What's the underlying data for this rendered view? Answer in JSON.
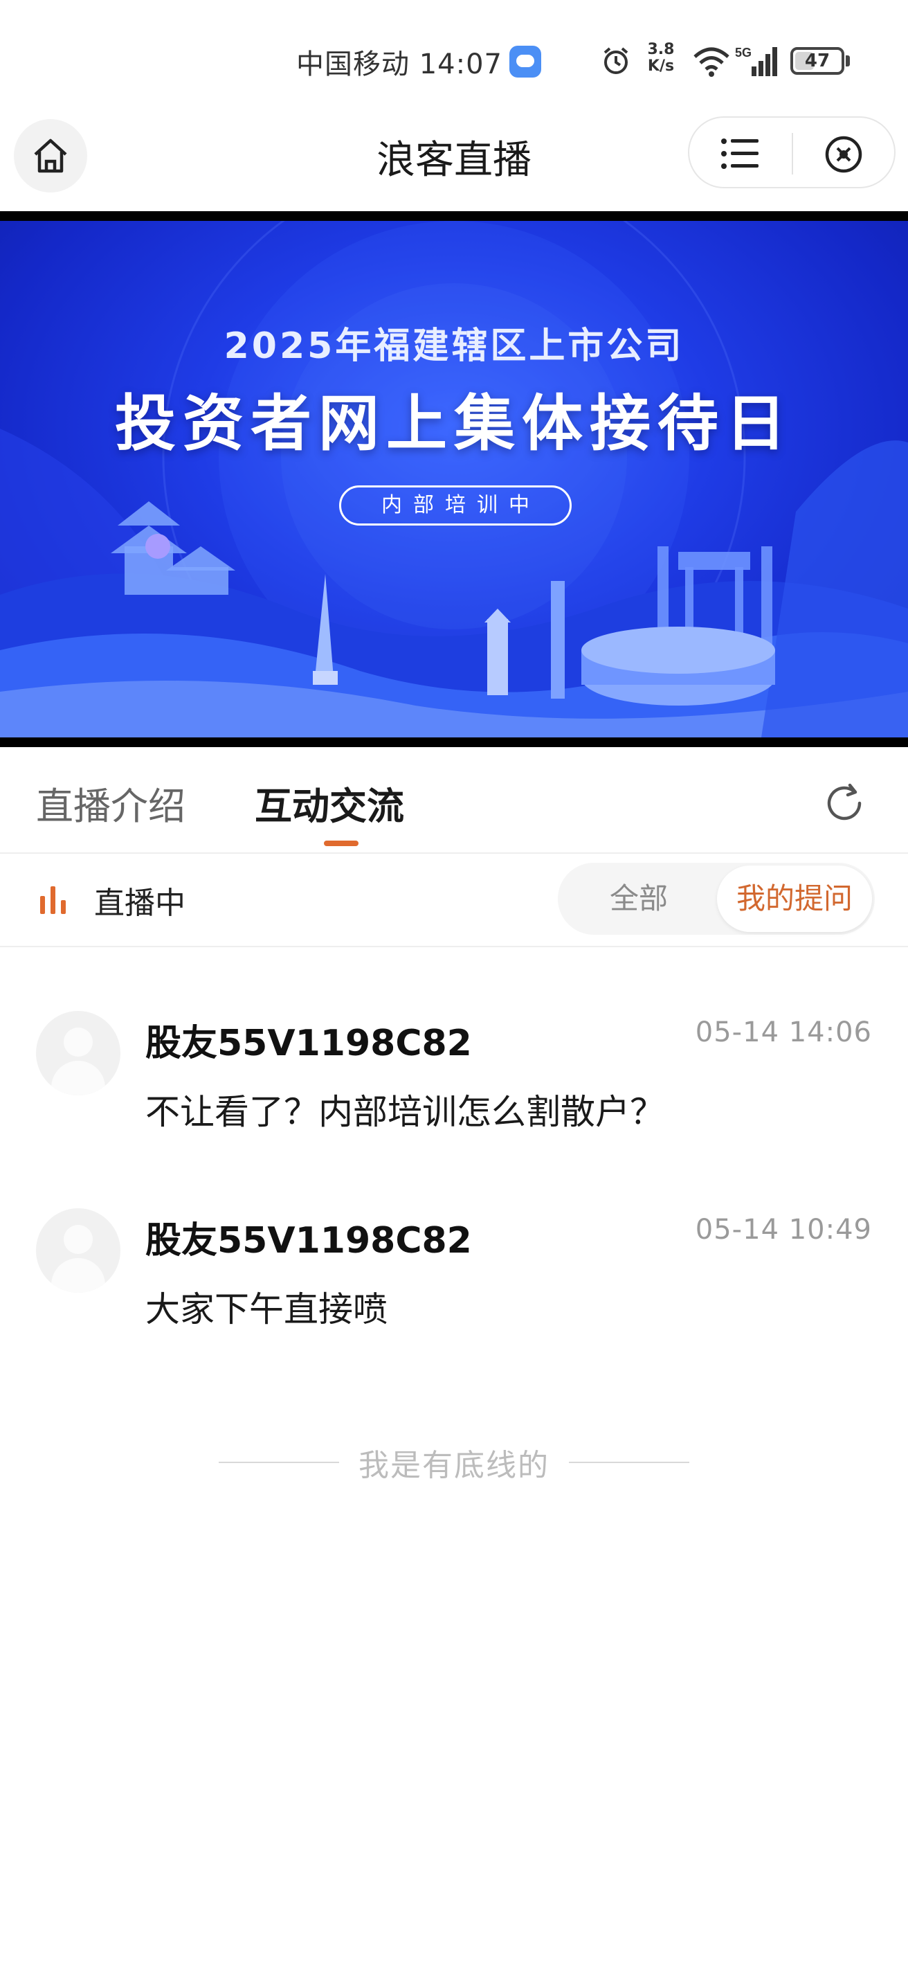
{
  "status_bar": {
    "carrier_time": "中国移动 14:07",
    "speed": "3.8\nK/s",
    "battery": "47",
    "battery_level": 0.47
  },
  "nav": {
    "title": "浪客直播"
  },
  "banner": {
    "year_line": "2025年福建辖区上市公司",
    "title": "投资者网上集体接待日",
    "pill": "内部培训中"
  },
  "tabs": [
    {
      "label": "直播介绍",
      "active": false
    },
    {
      "label": "互动交流",
      "active": true
    }
  ],
  "live": {
    "status": "直播中",
    "filter_all": "全部",
    "filter_mine": "我的提问",
    "accent": "#e06a2e"
  },
  "comments": [
    {
      "user": "股友55V1198C82",
      "time": "05-14 14:06",
      "text": "不让看了？内部培训怎么割散户？"
    },
    {
      "user": "股友55V1198C82",
      "time": "05-14 10:49",
      "text": "大家下午直接喷"
    }
  ],
  "footer": {
    "text": "我是有底线的"
  }
}
